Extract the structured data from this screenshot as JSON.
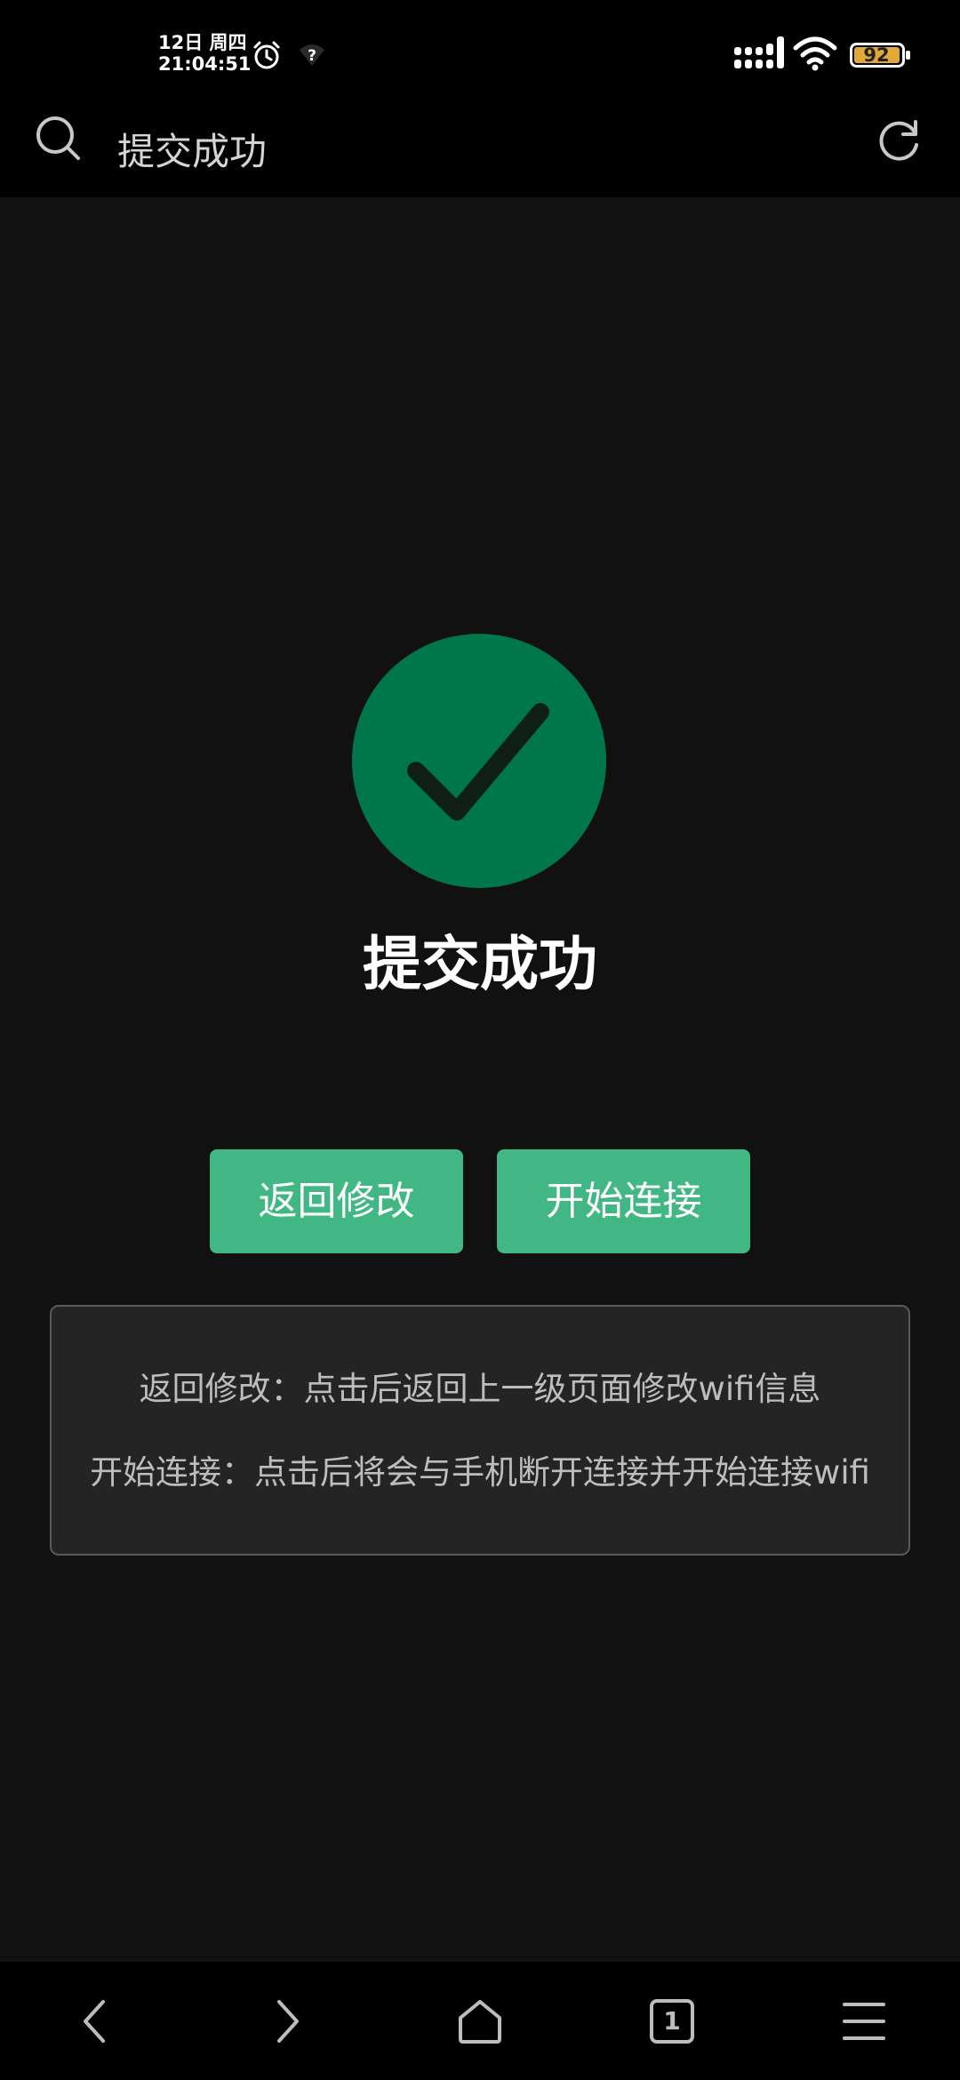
{
  "status_bar": {
    "date": "12日 周四",
    "time": "21:04:51",
    "battery": "92",
    "icons": [
      "alarm-icon",
      "unknown-network-icon",
      "signal-icon",
      "wifi-icon",
      "battery-icon"
    ]
  },
  "top_bar": {
    "title": "提交成功",
    "icons": [
      "search-icon",
      "refresh-icon"
    ]
  },
  "result": {
    "icon": "check-circle-icon",
    "title": "提交成功"
  },
  "actions": {
    "back_label": "返回修改",
    "connect_label": "开始连接"
  },
  "info": {
    "line1": "返回修改：点击后返回上一级页面修改wifi信息",
    "line2": "开始连接：点击后将会与手机断开连接并开始连接wifi"
  },
  "bottom_nav": {
    "tab_count": "1",
    "icons": [
      "back-icon",
      "forward-icon",
      "home-icon",
      "tabs-icon",
      "menu-icon"
    ]
  },
  "colors": {
    "accent": "#41b883",
    "success_circle": "#00774a",
    "background": "#111111",
    "bar": "#000000",
    "battery_fill": "#e0a93a"
  }
}
